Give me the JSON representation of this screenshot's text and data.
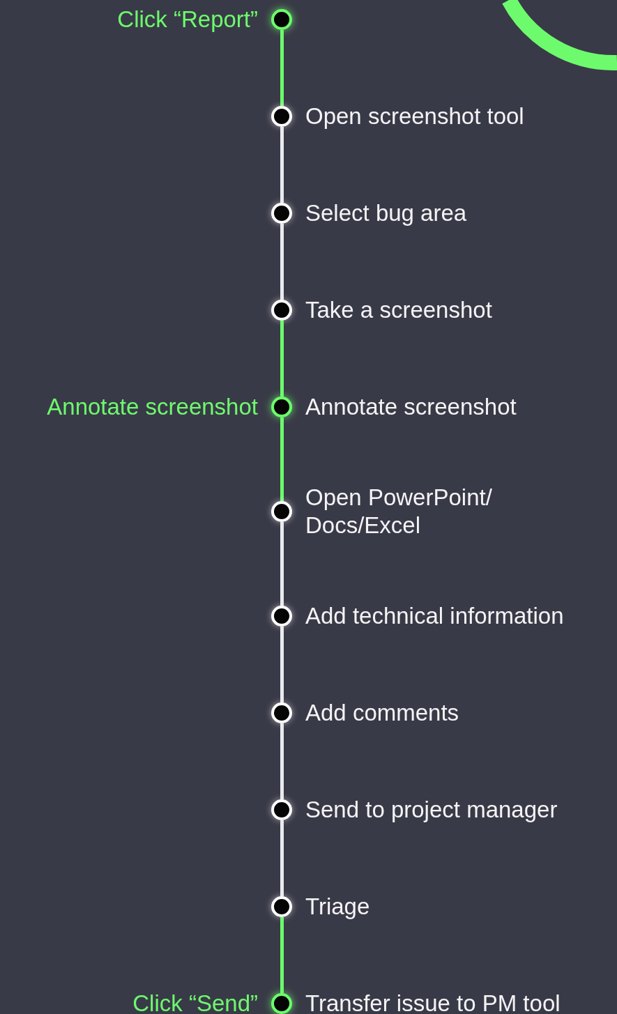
{
  "steps": [
    {
      "highlighted": true,
      "side_label": "Click “Report”"
    },
    {
      "label": "Open screenshot tool",
      "highlighted": false
    },
    {
      "label": "Select bug area",
      "highlighted": false
    },
    {
      "label": "Take a screenshot",
      "highlighted": false
    },
    {
      "label": "Annotate screenshot",
      "highlighted": true,
      "side_label": "Annotate screenshot"
    },
    {
      "label": "Open PowerPoint/\nDocs/Excel",
      "highlighted": false
    },
    {
      "label": "Add technical information",
      "highlighted": false
    },
    {
      "label": "Add comments",
      "highlighted": false
    },
    {
      "label": "Send to project manager",
      "highlighted": false
    },
    {
      "label": "Triage",
      "highlighted": false
    },
    {
      "label": "Transfer issue to PM tool",
      "highlighted": true,
      "side_label": "Click “Send”"
    }
  ]
}
